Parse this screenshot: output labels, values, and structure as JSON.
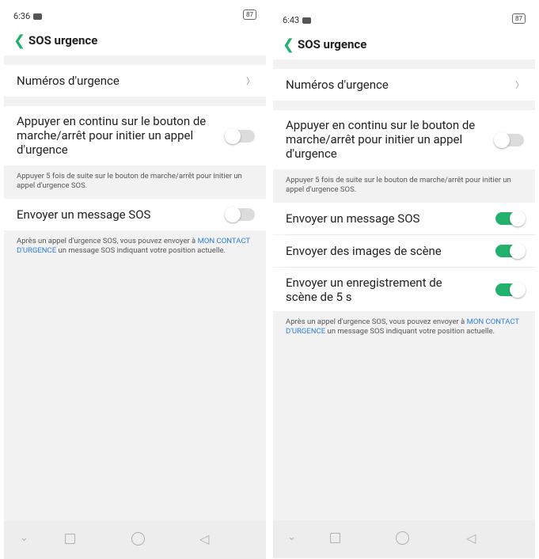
{
  "screens": [
    {
      "status": {
        "time": "6:36",
        "battery": "87"
      },
      "title": "SOS urgence",
      "emergency_numbers": "Numéros d'urgence",
      "power_button_label": "Appuyer en continu sur le bouton de marche/arrêt pour initier un appel d'urgence",
      "power_button_toggle": "off",
      "power_note": "Appuyer 5 fois de suite sur le bouton de marche/arrêt pour initier un appel d'urgence SOS.",
      "send_sos": "Envoyer un message SOS",
      "send_sos_toggle": "off",
      "sos_note_prefix": "Après un appel d'urgence SOS, vous pouvez envoyer à ",
      "sos_note_link": "MON CONTACT D'URGENCE",
      "sos_note_suffix": " un message SOS indiquant votre position actuelle."
    },
    {
      "status": {
        "time": "6:43",
        "battery": "87"
      },
      "title": "SOS urgence",
      "emergency_numbers": "Numéros d'urgence",
      "power_button_label": "Appuyer en continu sur le bouton de marche/arrêt pour initier un appel d'urgence",
      "power_button_toggle": "off",
      "power_note": "Appuyer 5 fois de suite sur le bouton de marche/arrêt pour initier un appel d'urgence SOS.",
      "send_sos": "Envoyer un message SOS",
      "send_sos_toggle": "on",
      "send_images": "Envoyer des images de scène",
      "send_images_toggle": "on",
      "send_recording": "Envoyer un enregistrement de scène de 5 s",
      "send_recording_toggle": "on",
      "sos_note_prefix": "Après un appel d'urgence SOS, vous pouvez envoyer à ",
      "sos_note_link": "MON CONTACT D'URGENCE",
      "sos_note_suffix": " un message SOS indiquant votre position actuelle."
    }
  ],
  "colors": {
    "accent": "#23b26d",
    "link": "#2a7de1",
    "background": "#f2f2f2"
  },
  "icons": {
    "back": "chevron-left-icon",
    "nav": [
      "chevron-down-icon",
      "square-icon",
      "circle-icon",
      "triangle-left-icon"
    ]
  }
}
